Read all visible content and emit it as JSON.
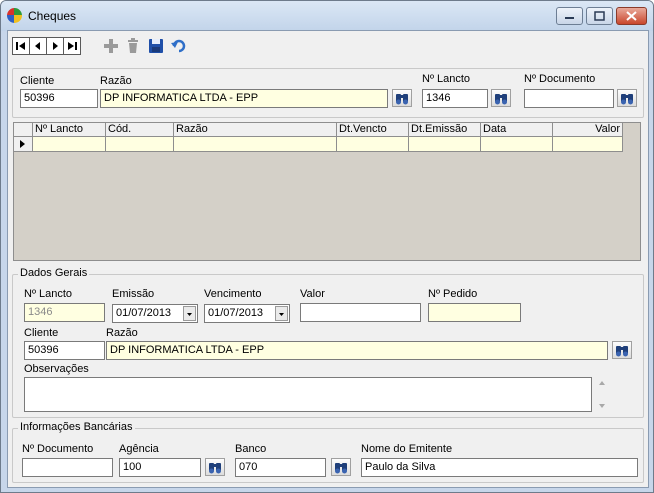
{
  "window": {
    "title": "Cheques"
  },
  "toolbar": {
    "add": "add",
    "delete": "delete",
    "save": "save",
    "undo": "undo"
  },
  "header": {
    "cliente_label": "Cliente",
    "cliente_value": "50396",
    "razao_label": "Razão",
    "razao_value": "DP INFORMATICA LTDA - EPP",
    "lancto_label": "Nº Lancto",
    "lancto_value": "1346",
    "documento_label": "Nº Documento",
    "documento_value": ""
  },
  "grid": {
    "columns": [
      "Nº Lancto",
      "Cód.",
      "Razão",
      "Dt.Vencto",
      "Dt.Emissão",
      "Data",
      "Valor"
    ]
  },
  "dados_gerais": {
    "title": "Dados Gerais",
    "lancto_label": "Nº Lancto",
    "lancto_value": "1346",
    "emissao_label": "Emissão",
    "emissao_value": "01/07/2013",
    "vencimento_label": "Vencimento",
    "vencimento_value": "01/07/2013",
    "valor_label": "Valor",
    "valor_value": "",
    "pedido_label": "Nº Pedido",
    "pedido_value": "",
    "cliente_label": "Cliente",
    "cliente_value": "50396",
    "razao_label": "Razão",
    "razao_value": "DP INFORMATICA LTDA - EPP",
    "obs_label": "Observações",
    "obs_value": ""
  },
  "bancarias": {
    "title": "Informações Bancárias",
    "documento_label": "Nº Documento",
    "documento_value": "",
    "agencia_label": "Agência",
    "agencia_value": "100",
    "banco_label": "Banco",
    "banco_value": "070",
    "emitente_label": "Nome do Emitente",
    "emitente_value": "Paulo da Silva"
  },
  "colors": {
    "yellow_field": "#ffffe1",
    "grid_bg": "#d4d0c8",
    "frame": "#c7d6ea"
  }
}
